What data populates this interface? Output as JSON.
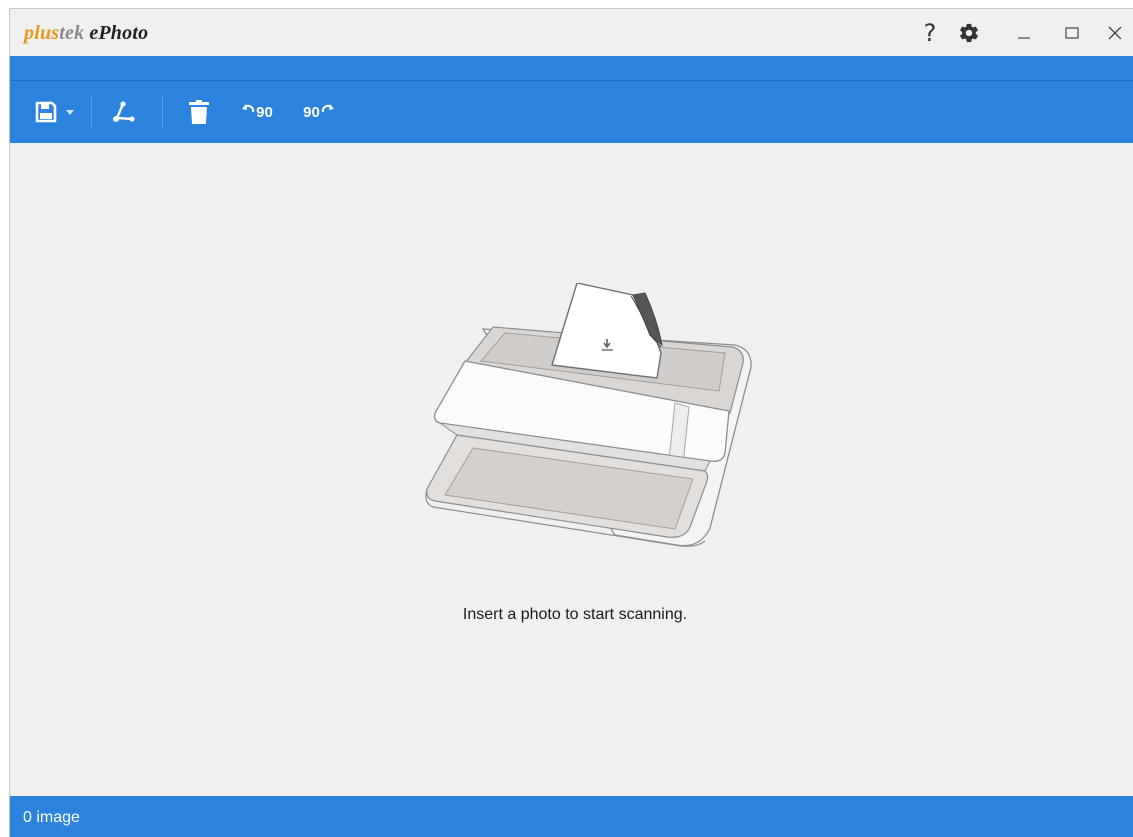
{
  "window": {
    "logo": {
      "part1": "plus",
      "part2": "tek",
      "app_name": "ePhoto"
    },
    "title_controls": {
      "help": "?",
      "settings_icon": "gear-icon",
      "minimize_icon": "minimize-icon",
      "maximize_icon": "maximize-icon",
      "close_icon": "close-icon"
    }
  },
  "toolbar": {
    "items": [
      {
        "name": "save-button",
        "icon": "floppy-disk-icon"
      },
      {
        "name": "save-dropdown-button",
        "icon": "caret-down-icon"
      },
      {
        "name": "share-button",
        "icon": "share-nodes-icon"
      },
      {
        "name": "delete-button",
        "icon": "trash-icon"
      },
      {
        "name": "rotate-left-button",
        "icon": "rotate-left-icon",
        "label": "90"
      },
      {
        "name": "rotate-right-button",
        "icon": "rotate-right-icon",
        "label": "90"
      }
    ]
  },
  "main": {
    "illustration": "scanner-with-photo-illustration",
    "hint": "Insert a photo to start scanning."
  },
  "status": {
    "image_count_text": "0 image"
  },
  "colors": {
    "accent_blue": "#2c83dd",
    "logo_orange": "#e8971d",
    "logo_gray": "#8a8a8a",
    "background": "#f0f0f0"
  }
}
